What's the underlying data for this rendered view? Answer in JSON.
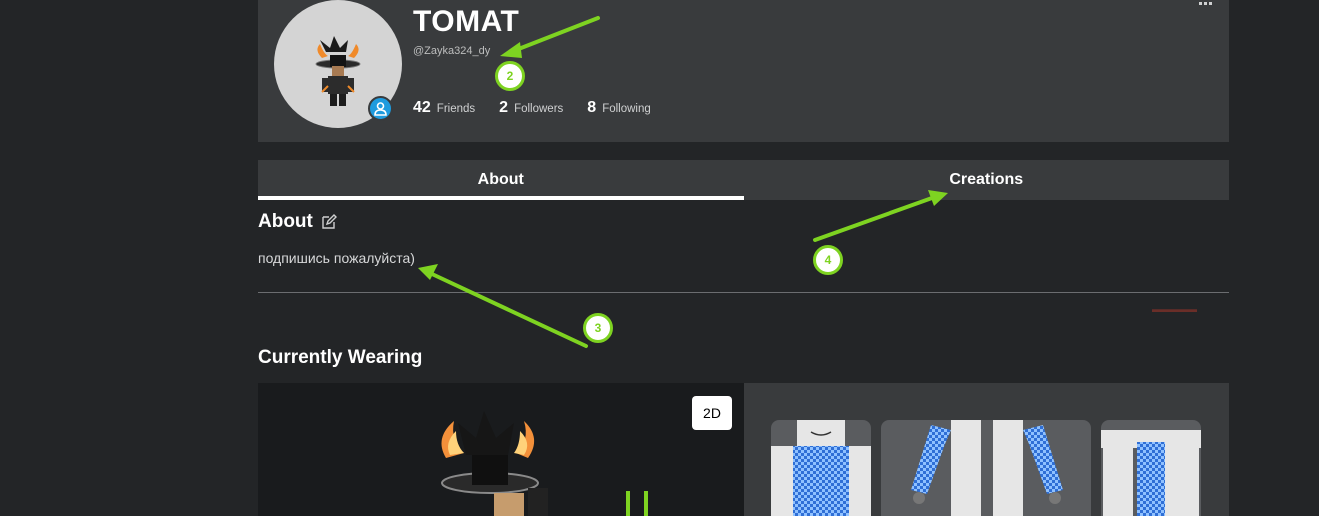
{
  "profile": {
    "display_name": "TOMAT",
    "username": "@Zayka324_dy",
    "stats": [
      {
        "value": "42",
        "label": "Friends"
      },
      {
        "value": "2",
        "label": "Followers"
      },
      {
        "value": "8",
        "label": "Following"
      }
    ]
  },
  "tabs": [
    {
      "label": "About",
      "active": true
    },
    {
      "label": "Creations",
      "active": false
    }
  ],
  "about": {
    "title": "About",
    "text": "подпишись пожалуйста)"
  },
  "wearing": {
    "title": "Currently Wearing",
    "toggle_label": "2D"
  },
  "annotations": [
    "2",
    "3",
    "4"
  ],
  "colors": {
    "accent_green": "#7ed321",
    "presence_blue": "#1f9bde"
  }
}
